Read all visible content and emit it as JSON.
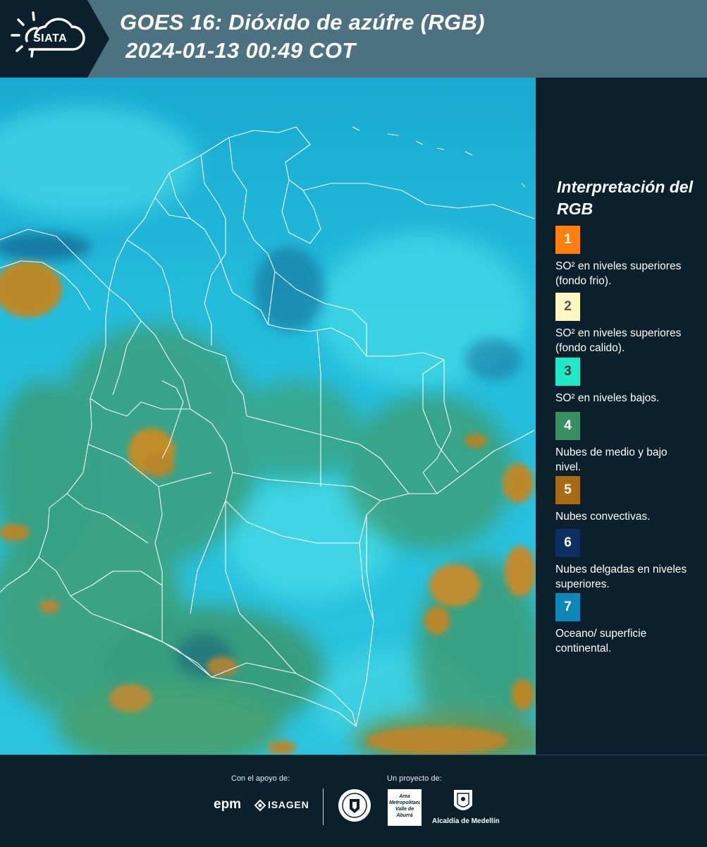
{
  "header": {
    "logo_text": "SIATA",
    "title_line1": "GOES 16: Dióxido de azúfre (RGB)",
    "title_line2": "2024-01-13 00:49 COT"
  },
  "legend": {
    "title": "Interpretación del RGB",
    "items": [
      {
        "number": "1",
        "text": "SO² en niveles superiores (fondo frio).",
        "color": "#ff7f0f",
        "text_color": "#ffffff"
      },
      {
        "number": "2",
        "text": "SO² en niveles superiores (fondo calido).",
        "color": "#fff7c2",
        "text_color": "#555555"
      },
      {
        "number": "3",
        "text": "SO² en niveles bajos.",
        "color": "#22e8c8",
        "text_color": "#333333"
      },
      {
        "number": "4",
        "text": "Nubes de medio y bajo nivel.",
        "color": "#3a8f62",
        "text_color": "#ffffff"
      },
      {
        "number": "5",
        "text": "Nubes convectivas.",
        "color": "#a86a14",
        "text_color": "#ffffff"
      },
      {
        "number": "6",
        "text": "Nubes delgadas en niveles superiores.",
        "color": "#0e2f62",
        "text_color": "#ffffff"
      },
      {
        "number": "7",
        "text": "Oceano/ superficie continental.",
        "color": "#0e86b8",
        "text_color": "#ffffff"
      }
    ]
  },
  "footer": {
    "support_label": "Con el apoyo de:",
    "project_label": "Un proyecto de:",
    "partners": [
      "epm",
      "ISAGEN",
      "Área Metropolitana Valle de Aburrá",
      "Alcaldía de Medellín"
    ]
  },
  "colors": {
    "background": "#0c1f2c",
    "header_bar": "#4c7282",
    "map_base": "#20b6d8",
    "map_land_green": "#3f9a6a",
    "map_convective": "#b9892e",
    "borders": "#ffffff"
  }
}
